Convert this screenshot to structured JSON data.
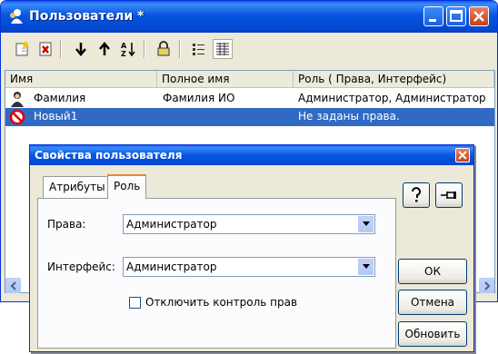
{
  "window": {
    "title": "Пользователи *"
  },
  "toolbar": {
    "buttons": [
      "new-user-icon",
      "delete-user-icon",
      "move-down-icon",
      "move-up-icon",
      "sort-icon",
      "lock-icon",
      "list-view-icon",
      "details-view-icon"
    ]
  },
  "list": {
    "columns": [
      "Имя",
      "Полное имя",
      "Роль ( Права, Интерфейс)"
    ],
    "rows": [
      {
        "name": "Фамилия",
        "full_name": "Фамилия ИО",
        "role": "Администратор, Администратор",
        "icon": "user-icon",
        "selected": false
      },
      {
        "name": "Новый1",
        "full_name": "",
        "role": "Не заданы права.",
        "icon": "forbidden-icon",
        "selected": true
      }
    ]
  },
  "dialog": {
    "title": "Свойства пользователя",
    "tabs": [
      "Атрибуты",
      "Роль"
    ],
    "active_tab": "Роль",
    "rights_label": "Права:",
    "rights_value": "Администратор",
    "interface_label": "Интерфейс:",
    "interface_value": "Администратор",
    "disable_check_label": "Отключить контроль прав",
    "disable_check_checked": false,
    "ok_label": "ОК",
    "cancel_label": "Отмена",
    "refresh_label": "Обновить",
    "help_label": "?"
  },
  "colors": {
    "title_blue": "#0348d1",
    "selection": "#316ac5",
    "close_red": "#c63f1d"
  }
}
